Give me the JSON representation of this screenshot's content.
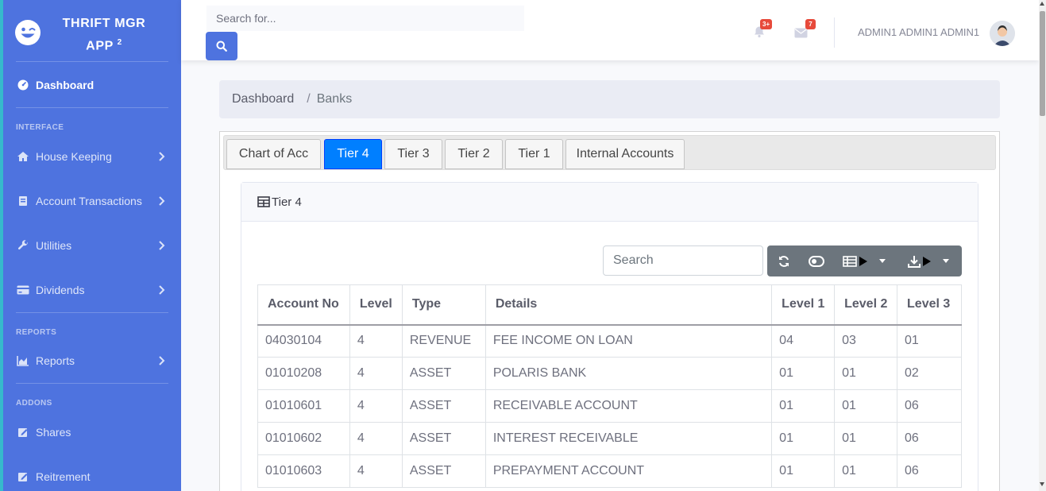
{
  "app": {
    "brand_line1": "THRIFT MGR",
    "brand_line2": "APP",
    "brand_sup": "2"
  },
  "sidebar": {
    "dashboard": "Dashboard",
    "section_interface": "INTERFACE",
    "house_keeping": "House Keeping",
    "account_transactions": "Account Transactions",
    "utilities": "Utilities",
    "dividends": "Dividends",
    "section_reports": "REPORTS",
    "reports": "Reports",
    "section_addons": "ADDONS",
    "shares": "Shares",
    "retirement": "Reitrement"
  },
  "topbar": {
    "search_placeholder": "Search for...",
    "alerts_badge": "3+",
    "messages_badge": "7",
    "user_name": "ADMIN1 ADMIN1 ADMIN1"
  },
  "breadcrumb": {
    "home": "Dashboard",
    "separator": "/",
    "current": "Banks"
  },
  "tabs": [
    "Chart of Acc",
    "Tier 4",
    "Tier 3",
    "Tier 2",
    "Tier 1",
    "Internal Accounts"
  ],
  "active_tab": "Tier 4",
  "card": {
    "title": "Tier 4",
    "search_placeholder": "Search"
  },
  "table": {
    "headers": [
      "Account No",
      "Level",
      "Type",
      "Details",
      "Level 1",
      "Level 2",
      "Level 3"
    ],
    "rows": [
      [
        "04030104",
        "4",
        "REVENUE",
        "FEE INCOME ON LOAN",
        "04",
        "03",
        "01"
      ],
      [
        "01010208",
        "4",
        "ASSET",
        "POLARIS BANK",
        "01",
        "01",
        "02"
      ],
      [
        "01010601",
        "4",
        "ASSET",
        "RECEIVABLE ACCOUNT",
        "01",
        "01",
        "06"
      ],
      [
        "01010602",
        "4",
        "ASSET",
        "INTEREST RECEIVABLE",
        "01",
        "01",
        "06"
      ],
      [
        "01010603",
        "4",
        "ASSET",
        "PREPAYMENT ACCOUNT",
        "01",
        "01",
        "06"
      ]
    ]
  },
  "colors": {
    "sidebar_bg": "#4e73df",
    "active_tab": "#007fff",
    "toolbar_bg": "#6c757d",
    "badge": "#e74a3b"
  },
  "icons": {
    "brand": "laugh-wink-icon",
    "dashboard": "tachometer-icon",
    "house_keeping": "home-icon",
    "account_transactions": "book-icon",
    "utilities": "wrench-icon",
    "dividends": "credit-card-icon",
    "reports": "chart-area-icon",
    "shares": "edit-icon",
    "retirement": "edit-icon",
    "alerts": "bell-icon",
    "messages": "envelope-icon",
    "refresh": "sync-icon",
    "toggle": "toggle-icon",
    "columns": "list-icon",
    "export": "download-icon"
  }
}
